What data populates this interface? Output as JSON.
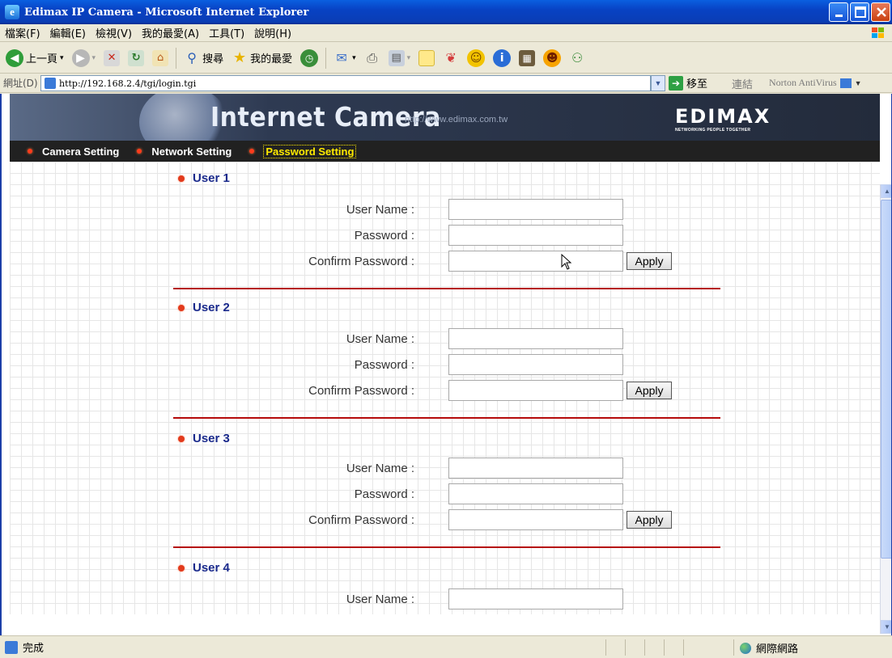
{
  "window": {
    "title": "Edimax IP Camera - Microsoft Internet Explorer"
  },
  "menu": [
    "檔案(F)",
    "編輯(E)",
    "檢視(V)",
    "我的最愛(A)",
    "工具(T)",
    "說明(H)"
  ],
  "toolbar": {
    "back_label": "上一頁",
    "search_label": "搜尋",
    "favorites_label": "我的最愛"
  },
  "address": {
    "label": "網址(D)",
    "url": "http://192.168.2.4/tgi/login.tgi",
    "go_label": "移至",
    "links_label": "連結",
    "norton_label": "Norton AntiVirus"
  },
  "banner": {
    "heading": "Internet Camera",
    "url": "http://www.edimax.com.tw",
    "logo": "EDIMAX",
    "tagline": "NETWORKING PEOPLE TOGETHER"
  },
  "nav": {
    "items": [
      "Camera Setting",
      "Network Setting",
      "Password Setting"
    ],
    "active": "Password Setting"
  },
  "form": {
    "user_name_label": "User Name :",
    "password_label": "Password :",
    "confirm_label": "Confirm Password :",
    "apply_label": "Apply",
    "users": [
      {
        "heading": "User 1",
        "user_name": "",
        "password": "",
        "confirm": ""
      },
      {
        "heading": "User 2",
        "user_name": "",
        "password": "",
        "confirm": ""
      },
      {
        "heading": "User 3",
        "user_name": "",
        "password": "",
        "confirm": ""
      },
      {
        "heading": "User 4",
        "user_name": ""
      }
    ]
  },
  "status": {
    "text": "完成",
    "zone": "網際網路"
  },
  "colors": {
    "titlebar": "#0842c4",
    "nav_bg": "#212121",
    "nav_active": "#ffea00",
    "section_heading": "#1a2a8c",
    "divider": "#b50b0b",
    "bullet": "#e23a1c"
  }
}
